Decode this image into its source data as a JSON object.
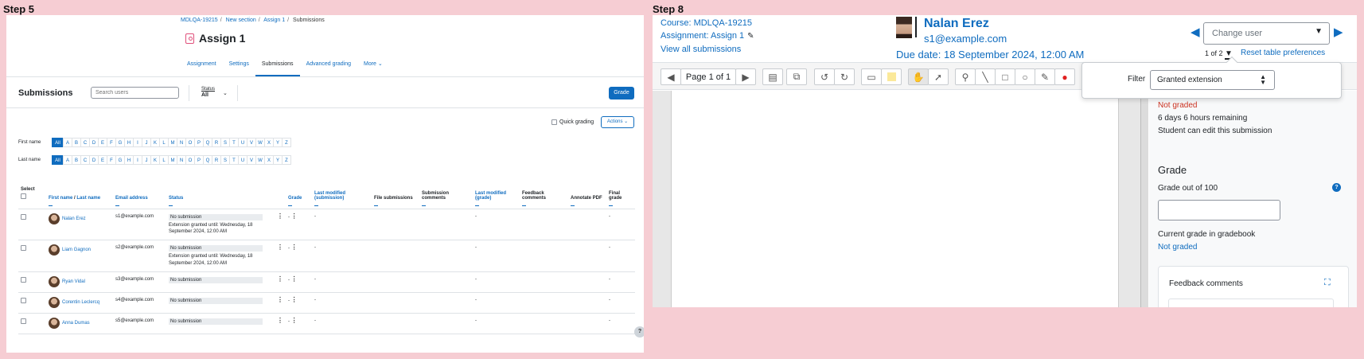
{
  "step_labels": {
    "left": "Step 5",
    "right": "Step 8"
  },
  "left": {
    "breadcrumb": [
      "MDLQA-19215",
      "New section",
      "Assign 1",
      "Submissions"
    ],
    "title": "Assign 1",
    "tabs": [
      "Assignment",
      "Settings",
      "Submissions",
      "Advanced grading",
      "More"
    ],
    "tab_more_chevron": "⌄",
    "active_tab": 2,
    "submissions_heading": "Submissions",
    "search_placeholder": "Search users",
    "status_filter": {
      "label": "Status",
      "value": "All",
      "chevron": "⌄"
    },
    "grade_button": "Grade",
    "quick_grading": "Quick grading",
    "actions_button": "Actions ⌄",
    "initials": {
      "first_label": "First name",
      "last_label": "Last name",
      "all": "All",
      "letters": [
        "A",
        "B",
        "C",
        "D",
        "E",
        "F",
        "G",
        "H",
        "I",
        "J",
        "K",
        "L",
        "M",
        "N",
        "O",
        "P",
        "Q",
        "R",
        "S",
        "T",
        "U",
        "V",
        "W",
        "X",
        "Y",
        "Z"
      ]
    },
    "columns": {
      "select": "Select",
      "name_first": "First name",
      "name_slash": " / ",
      "name_last": "Last name",
      "email": "Email address",
      "status": "Status",
      "grade": "Grade",
      "last_modified_submission": "Last modified (submission)",
      "file_submissions": "File submissions",
      "submission_comments": "Submission comments",
      "last_modified_grade": "Last modified (grade)",
      "feedback_comments": "Feedback comments",
      "annotate_pdf": "Annotate PDF",
      "final_grade": "Final grade"
    },
    "rows": [
      {
        "name": "Nalan Erez",
        "email": "s1@example.com",
        "status": "No submission",
        "extension": "Extension granted until: Wednesday, 18 September 2024, 12:00 AM",
        "grade": "-",
        "last_mod_sub": "-",
        "last_mod_grade": "-",
        "final": "-"
      },
      {
        "name": "Liam Gagnon",
        "email": "s2@example.com",
        "status": "No submission",
        "extension": "Extension granted until: Wednesday, 18 September 2024, 12:00 AM",
        "grade": "-",
        "last_mod_sub": "-",
        "last_mod_grade": "-",
        "final": "-"
      },
      {
        "name": "Ryan Vidal",
        "email": "s3@example.com",
        "status": "No submission",
        "extension": "",
        "grade": "-",
        "last_mod_sub": "-",
        "last_mod_grade": "-",
        "final": "-"
      },
      {
        "name": "Corentin Leclercq",
        "email": "s4@example.com",
        "status": "No submission",
        "extension": "",
        "grade": "-",
        "last_mod_sub": "-",
        "last_mod_grade": "-",
        "final": "-"
      },
      {
        "name": "Anna Dumas",
        "email": "s5@example.com",
        "status": "No submission",
        "extension": "",
        "grade": "-",
        "last_mod_sub": "-",
        "last_mod_grade": "-",
        "final": "-"
      }
    ],
    "kebab": "⋮",
    "help": "?"
  },
  "right": {
    "course_link": "Course: MDLQA-19215",
    "assignment_link": "Assignment: Assign 1",
    "view_all": "View all submissions",
    "user_name": "Nalan Erez",
    "user_email": "s1@example.com",
    "due_date": "Due date: 18 September 2024, 12:00 AM",
    "change_user_placeholder": "Change user",
    "pager_text": "1 of 2",
    "reset_prefs": "Reset table preferences",
    "page_label": "Page 1 of 1",
    "filter_label": "Filter",
    "filter_value": "Granted extension",
    "side": {
      "not_graded_status": "Not graded",
      "time_remaining": "6 days 6 hours remaining",
      "can_edit": "Student can edit this submission",
      "grade_heading": "Grade",
      "grade_out_of": "Grade out of 100",
      "current_grade_label": "Current grade in gradebook",
      "current_grade_value": "Not graded",
      "feedback_comments": "Feedback comments"
    },
    "colors": {
      "accent": "#0f6cbf",
      "danger": "#ca3120",
      "background": "#f6cdd3"
    }
  }
}
